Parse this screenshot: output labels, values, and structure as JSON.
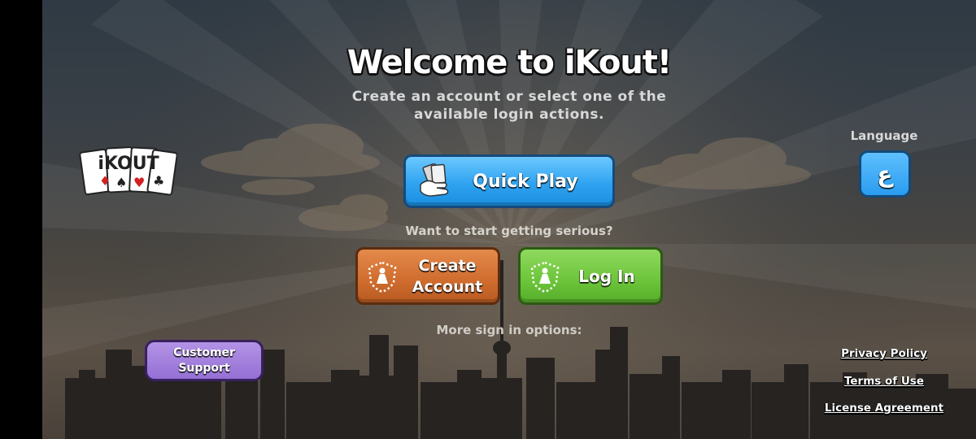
{
  "header": {
    "title": "Welcome to iKout!",
    "subtitle": "Create an account or select one of the available login actions."
  },
  "logo": {
    "text": "iKOUT"
  },
  "buttons": {
    "quick_play": "Quick Play",
    "create_account": "Create Account",
    "log_in": "Log In",
    "customer_support": "Customer Support",
    "language_glyph": "ع"
  },
  "labels": {
    "serious": "Want to start getting serious?",
    "more_options": "More sign in options:",
    "language": "Language"
  },
  "links": {
    "privacy": "Privacy Policy",
    "terms": "Terms of Use",
    "license": "License Agreement"
  },
  "colors": {
    "quick_play": "#2fa3f0",
    "create_account": "#cf6c2e",
    "log_in": "#6cc43a",
    "customer_support": "#9470d4",
    "language": "#2a9cef"
  },
  "icons": {
    "quick_play": "cards-hand-icon",
    "create_account": "pawn-shield-icon",
    "log_in": "pawn-shield-icon"
  }
}
